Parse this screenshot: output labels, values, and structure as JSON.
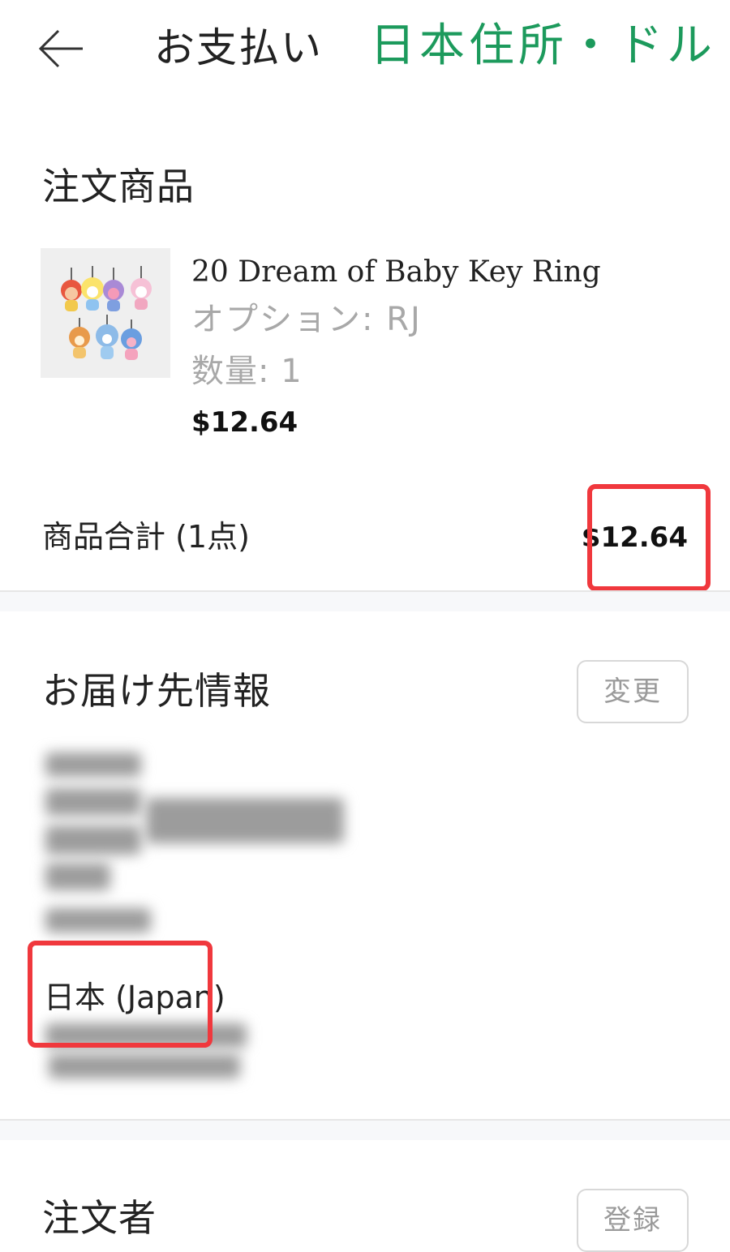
{
  "header": {
    "title": "お支払い",
    "overlay_text": "日本住所・ドル"
  },
  "order_items": {
    "title": "注文商品",
    "product": {
      "name": "20 Dream of Baby Key Ring",
      "option": "オプション: RJ",
      "quantity": "数量: 1",
      "price": "$12.64"
    },
    "subtotal_label": "商品合計 (1点)",
    "subtotal_value": "$12.64"
  },
  "shipping": {
    "title": "お届け先情報",
    "change_label": "変更",
    "country": "日本 (Japan)"
  },
  "orderer": {
    "title": "注文者",
    "register_label": "登録"
  },
  "colors": {
    "accent_green": "#1c9a5c",
    "highlight_red": "#f0383d"
  },
  "icons": {
    "back": "arrow-left-icon"
  }
}
